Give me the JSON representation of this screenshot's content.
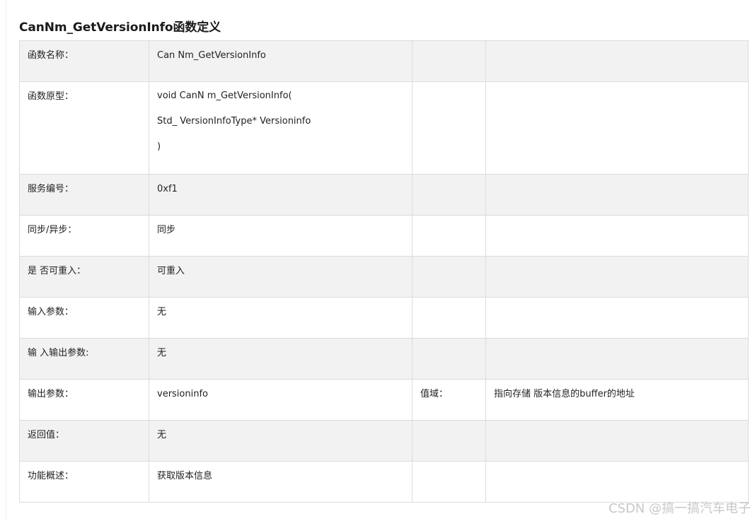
{
  "heading": "CanNm_GetVersionInfo函数定义",
  "rows": [
    {
      "label": "函数名称：",
      "value": "Can Nm_GetVersionInfo",
      "extra_label": "",
      "extra_value": ""
    },
    {
      "label": "函数原型：",
      "value_lines": [
        "void CanN m_GetVersionInfo(",
        "Std_ VersionInfoType* Versioninfo",
        ")"
      ],
      "extra_label": "",
      "extra_value": ""
    },
    {
      "label": "服务编号：",
      "value": "0xf1",
      "extra_label": "",
      "extra_value": ""
    },
    {
      "label": "同步/异步：",
      "value": "同步",
      "extra_label": "",
      "extra_value": ""
    },
    {
      "label": "是 否可重入：",
      "value": "可重入",
      "extra_label": "",
      "extra_value": ""
    },
    {
      "label": "输入参数：",
      "value": "无",
      "extra_label": "",
      "extra_value": ""
    },
    {
      "label": "输 入输出参数:",
      "value": "无",
      "extra_label": "",
      "extra_value": ""
    },
    {
      "label": "输出参数：",
      "value": "versioninfo",
      "extra_label": "值域：",
      "extra_value": "指向存储 版本信息的buffer的地址"
    },
    {
      "label": "返回值：",
      "value": "无",
      "extra_label": "",
      "extra_value": ""
    },
    {
      "label": "功能概述：",
      "value": "获取版本信息",
      "extra_label": "",
      "extra_value": ""
    }
  ],
  "watermark": "CSDN @搞一搞汽车电子"
}
